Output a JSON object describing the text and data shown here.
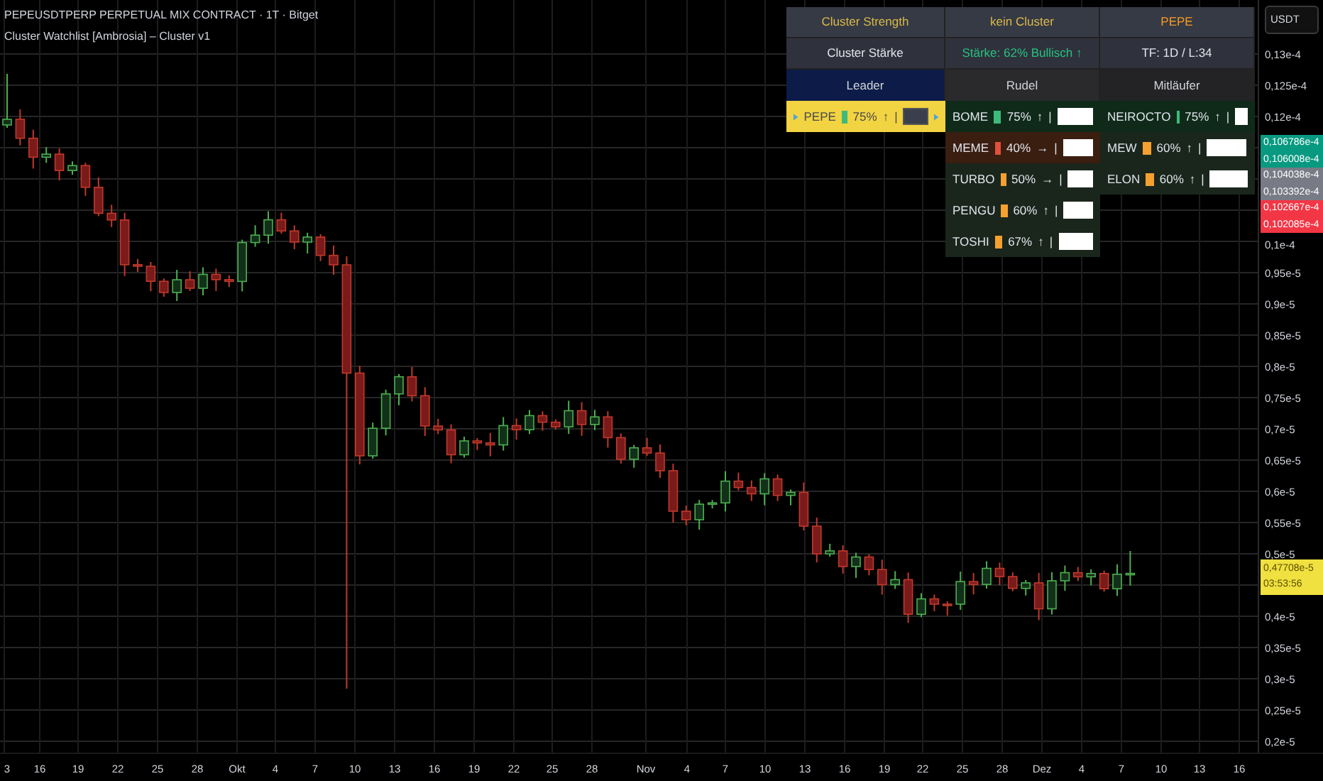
{
  "header": {
    "symbol": "PEPEUSDTPERP PERPETUAL MIX CONTRACT · 1T · Bitget",
    "indicator": "Cluster Watchlist [Ambrosia] – Cluster v1"
  },
  "currency_button": "USDT",
  "cluster_table": {
    "title_row": [
      {
        "text": "Cluster Strength",
        "color": "#d9b949"
      },
      {
        "text": "kein Cluster",
        "color": "#d9b949"
      },
      {
        "text": "PEPE",
        "color": "#f59a23"
      }
    ],
    "info_row": [
      {
        "text": "Cluster Stärke",
        "color": "#e0e3eb"
      },
      {
        "text": "Stärke: 62%  Bullisch ↑",
        "color": "#26c281"
      },
      {
        "text": "TF: 1D / L:34",
        "color": "#e0e3eb"
      }
    ],
    "column_headers": [
      "Leader",
      "Rudel",
      "Mitläufer"
    ],
    "leader": {
      "symbol": "PEPE",
      "color": "#3dbb7a",
      "percent": "75%",
      "trend": "↑",
      "separator": "|"
    },
    "rudel": [
      {
        "symbol": "BOME",
        "color": "#3dbb7a",
        "kind": "strong",
        "percent": "75%",
        "trend": "↑",
        "separator": "|"
      },
      {
        "symbol": "MEME",
        "color": "#e0503c",
        "kind": "weak",
        "percent": "40%",
        "trend": "→",
        "separator": "|"
      },
      {
        "symbol": "TURBO",
        "color": "#f5a030",
        "kind": "mid",
        "percent": "50%",
        "trend": "→",
        "separator": "|"
      },
      {
        "symbol": "PENGU",
        "color": "#f5a030",
        "kind": "mid",
        "percent": "60%",
        "trend": "↑",
        "separator": "|"
      },
      {
        "symbol": "TOSHI",
        "color": "#f5a030",
        "kind": "mid",
        "percent": "67%",
        "trend": "↑",
        "separator": "|"
      }
    ],
    "mitlaeufer": [
      {
        "symbol": "NEIROCTO",
        "color": "#3dbb7a",
        "kind": "strong",
        "percent": "75%",
        "trend": "↑",
        "separator": "|"
      },
      {
        "symbol": "MEW",
        "color": "#f5a030",
        "kind": "mid",
        "percent": "60%",
        "trend": "↑",
        "separator": "|"
      },
      {
        "symbol": "ELON",
        "color": "#f5a030",
        "kind": "mid",
        "percent": "60%",
        "trend": "↑",
        "separator": "|"
      }
    ]
  },
  "price_labels": [
    {
      "text": "0,106786e-4",
      "color": "#089981"
    },
    {
      "text": "0,106008e-4",
      "color": "#089981"
    },
    {
      "text": "0,104038e-4",
      "color": "#787b86"
    },
    {
      "text": "0,103392e-4",
      "color": "#787b86"
    },
    {
      "text": "0,102667e-4",
      "color": "#f23645"
    },
    {
      "text": "0,102085e-4",
      "color": "#f23645"
    }
  ],
  "current_price": {
    "price": "0,47708e-5",
    "countdown": "03:53:56"
  },
  "y_axis": [
    "0,13e-4",
    "0,125e-4",
    "0,12e-4",
    "0,1e-4",
    "0,95e-5",
    "0,9e-5",
    "0,85e-5",
    "0,8e-5",
    "0,75e-5",
    "0,7e-5",
    "0,65e-5",
    "0,6e-5",
    "0,55e-5",
    "0,5e-5",
    "0,4e-5",
    "0,35e-5",
    "0,3e-5",
    "0,25e-5",
    "0,2e-5"
  ],
  "x_axis": [
    "3",
    "16",
    "19",
    "22",
    "25",
    "28",
    "Okt",
    "4",
    "7",
    "10",
    "13",
    "16",
    "19",
    "22",
    "25",
    "28",
    "Nov",
    "4",
    "7",
    "10",
    "13",
    "16",
    "19",
    "22",
    "25",
    "28",
    "Dez",
    "4",
    "7",
    "10",
    "13",
    "16"
  ]
}
